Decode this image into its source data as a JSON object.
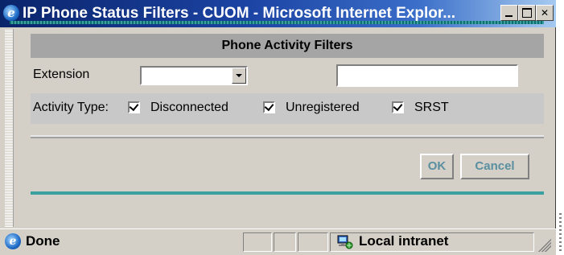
{
  "window": {
    "title": "IP Phone Status Filters - CUOM - Microsoft Internet Explor...",
    "controls": [
      "minimize-icon",
      "maximize-icon",
      "close-icon"
    ]
  },
  "panel": {
    "header": "Phone Activity Filters",
    "extension_label": "Extension",
    "extension_select_value": "",
    "extension_text_value": "",
    "activity_label": "Activity Type:",
    "activity_options": [
      {
        "label": "Disconnected",
        "checked": true
      },
      {
        "label": "Unregistered",
        "checked": true
      },
      {
        "label": "SRST",
        "checked": true
      }
    ],
    "ok_label": "OK",
    "cancel_label": "Cancel",
    "button_text_color": "#5a8fa0",
    "accent_color": "#3aa0a0"
  },
  "statusbar": {
    "status_text": "Done",
    "zone_text": "Local intranet"
  }
}
